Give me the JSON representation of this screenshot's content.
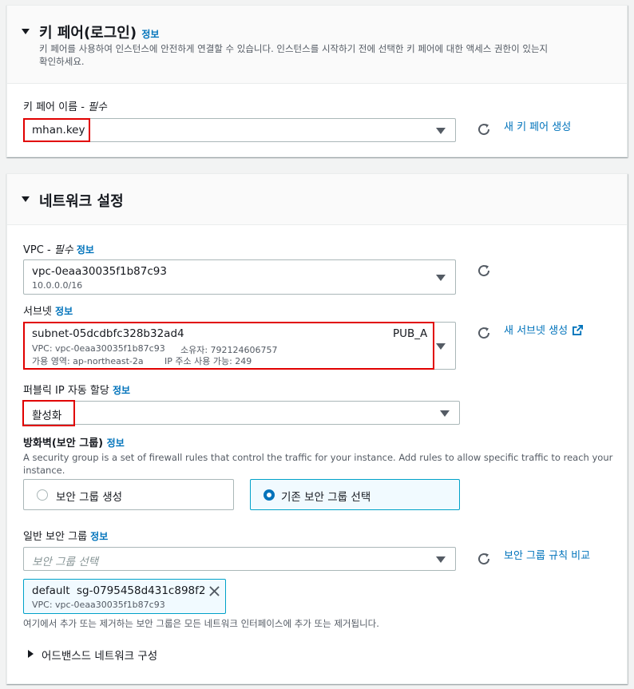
{
  "keypair": {
    "title": "키 페어(로그인)",
    "info": "정보",
    "description_line1": "키 페어를 사용하여 인스턴스에 안전하게 연결할 수 있습니다. 인스턴스를 시작하기 전에 선택한 키 페어에 대한 액세스 권한이 있는지",
    "description_line2": "확인하세요.",
    "field_label": "키 페어 이름 - ",
    "field_required": "필수",
    "selected": "mhan.key",
    "create_link": "새 키 페어 생성"
  },
  "network": {
    "title": "네트워크 설정",
    "vpc": {
      "label": "VPC - ",
      "required": "필수",
      "info": "정보",
      "value": "vpc-0eaa30035f1b87c93",
      "cidr": "10.0.0.0/16"
    },
    "subnet": {
      "label": "서브넷",
      "info": "정보",
      "value": "subnet-05dcdbfc328b32ad4",
      "name": "PUB_A",
      "vpc_line": "VPC: vpc-0eaa30035f1b87c93",
      "owner_line": "소유자: 792124606757",
      "az_line": "가용 영역: ap-northeast-2a",
      "ip_line": "IP 주소 사용 가능: 249",
      "create_link": "새 서브넷 생성"
    },
    "public_ip": {
      "label": "퍼블릭 IP 자동 할당",
      "info": "정보",
      "value": "활성화"
    },
    "firewall": {
      "label": "방화벽(보안 그룹)",
      "info": "정보",
      "description_line1": "A security group is a set of firewall rules that control the traffic for your instance. Add rules to allow specific traffic to reach your",
      "description_line2": "instance.",
      "option_create": "보안 그룹 생성",
      "option_existing": "기존 보안 그룹 선택"
    },
    "common_sg": {
      "label": "일반 보안 그룹",
      "info": "정보",
      "placeholder": "보안 그룹 선택",
      "compare_link": "보안 그룹 규칙 비교",
      "token_name": "default",
      "token_id": "sg-0795458d431c898f2",
      "token_vpc": "VPC: vpc-0eaa30035f1b87c93",
      "note": "여기에서 추가 또는 제거하는 보안 그룹은 모든 네트워크 인터페이스에 추가 또는 제거됩니다."
    },
    "advanced": "어드밴스드 네트워크 구성"
  },
  "colors": {
    "link": "#0073bb",
    "highlight": "#e10000",
    "selected_border": "#00a1c9"
  }
}
